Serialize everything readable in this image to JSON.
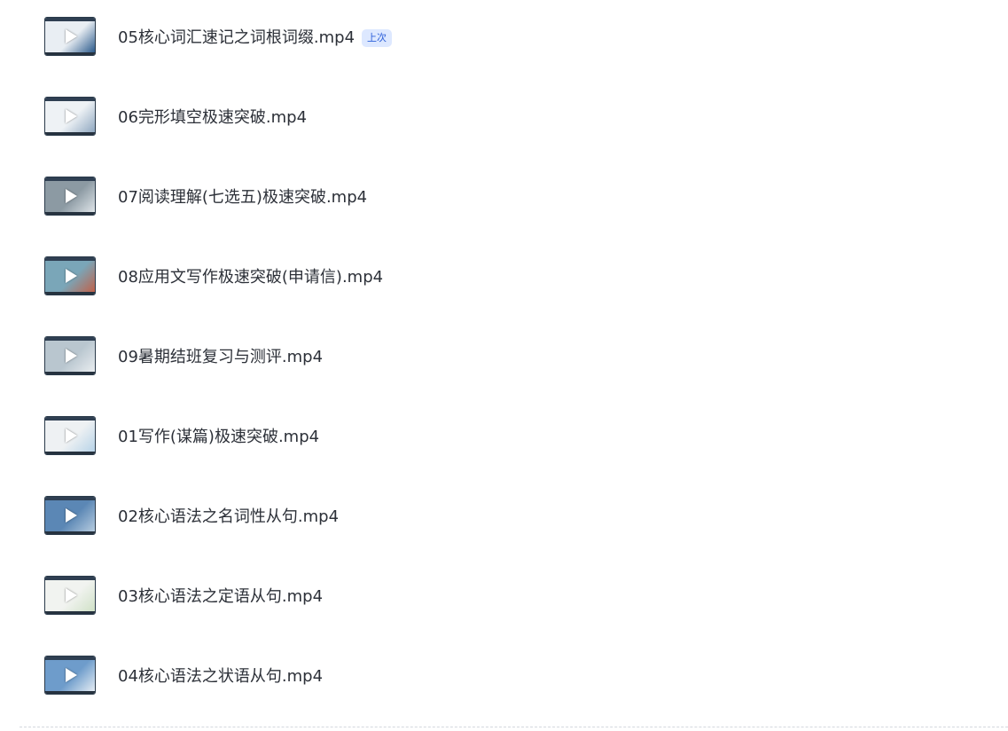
{
  "files": [
    {
      "name": "05核心词汇速记之词根词缀.mp4",
      "badge": "上次",
      "thumb": {
        "bg": "#e9eef3",
        "accent": "#2b5a8c"
      }
    },
    {
      "name": "06完形填空极速突破.mp4",
      "badge": "",
      "thumb": {
        "bg": "#eef2f5",
        "accent": "#8fa7c0"
      }
    },
    {
      "name": "07阅读理解(七选五)极速突破.mp4",
      "badge": "",
      "thumb": {
        "bg": "#8c9aa3",
        "accent": "#dfe5e9"
      }
    },
    {
      "name": "08应用文写作极速突破(申请信).mp4",
      "badge": "",
      "thumb": {
        "bg": "#7aa6b8",
        "accent": "#c0614a"
      }
    },
    {
      "name": "09暑期结班复习与测评.mp4",
      "badge": "",
      "thumb": {
        "bg": "#b9c6cf",
        "accent": "#e9edf0"
      }
    },
    {
      "name": "01写作(谋篇)极速突破.mp4",
      "badge": "",
      "thumb": {
        "bg": "#eef1f3",
        "accent": "#b7d3e8"
      }
    },
    {
      "name": "02核心语法之名词性从句.mp4",
      "badge": "",
      "thumb": {
        "bg": "#5b87b5",
        "accent": "#b6ccdf"
      }
    },
    {
      "name": "03核心语法之定语从句.mp4",
      "badge": "",
      "thumb": {
        "bg": "#f1f3f0",
        "accent": "#cfe1c6"
      }
    },
    {
      "name": "04核心语法之状语从句.mp4",
      "badge": "",
      "thumb": {
        "bg": "#6e9ccb",
        "accent": "#e5edf4"
      }
    }
  ]
}
